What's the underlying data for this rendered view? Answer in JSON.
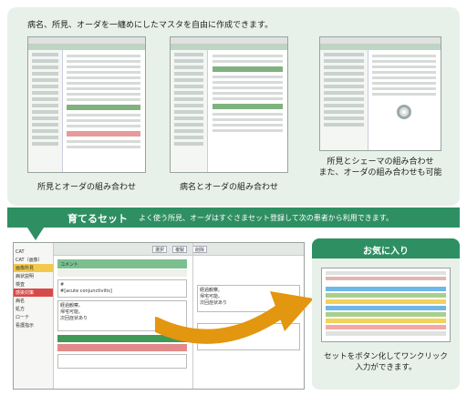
{
  "intro": "病名、所見、オーダを一纏めにしたマスタを自由に作成できます。",
  "captions": {
    "c1": "所見とオーダの組み合わせ",
    "c2": "病名とオーダの組み合わせ",
    "c3a": "所見とシェーマの組み合わせ",
    "c3b": "また、オーダの組み合わせも可能"
  },
  "banner": {
    "title": "育てるセット",
    "desc": "よく使う所見、オーダはすぐさまセット登録して次の患者から利用できます。"
  },
  "favorites": {
    "title": "お気に入り",
    "caption1": "セットをボタン化してワンクリック",
    "caption2": "入力ができます。"
  },
  "app": {
    "sidebar": [
      "CAT",
      "CAT（画像）",
      "画像所見",
      "病状説明",
      "検査",
      "感染対策",
      "病名",
      "処方",
      "ローテ",
      "看護指示"
    ],
    "toolbar": [
      "選択",
      "複製",
      "削除"
    ],
    "tab": "コメント",
    "note": "経過観察。\n帰宅可能。\n次回症状あり",
    "box_label": "#",
    "form_label": "#[acute conjunctivitis]"
  },
  "colors": {
    "accent": "#2e8f62",
    "panel": "#e7f1ea",
    "arrow": "#e3960f"
  }
}
